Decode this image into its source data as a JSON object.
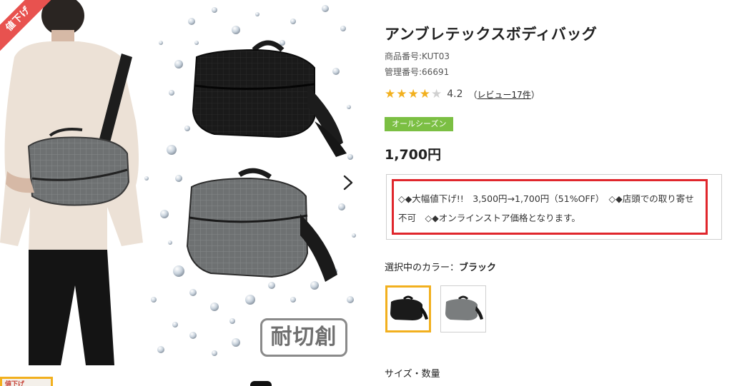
{
  "product": {
    "title": "アンブレテックスボディバッグ",
    "sku": "商品番号:KUT03",
    "management_no": "管理番号:66691",
    "rating_score": "4.2",
    "rating_value": 4.2,
    "review_open": "（",
    "review_link": "レビュー17件",
    "review_close": "）",
    "season_badge": "オールシーズン",
    "price": "1,700円",
    "notice": "◇◆大幅値下げ!!　3,500円→1,700円（51%OFF）　◇◆店頭での取り寄せ不可　◇◆オンラインストア価格となります。",
    "color_label_prefix": "選択中のカラー：",
    "color_label_value": "ブラック",
    "size_label": "サイズ・数量"
  },
  "gallery": {
    "ribbon_text": "値下げ",
    "feature_badge": "耐切創",
    "thumb_ribbon": "値下げ",
    "next_icon": "chevron-right-icon"
  },
  "colors": {
    "accent_star": "#f2b01e",
    "season_badge_bg": "#7bbf43",
    "notice_border": "#e0262c",
    "ribbon_bg": "#e8524f",
    "selected_swatch_border": "#f2b01e"
  },
  "swatches": [
    {
      "name": "ブラック",
      "selected": true
    },
    {
      "name": "グレー",
      "selected": false
    }
  ]
}
